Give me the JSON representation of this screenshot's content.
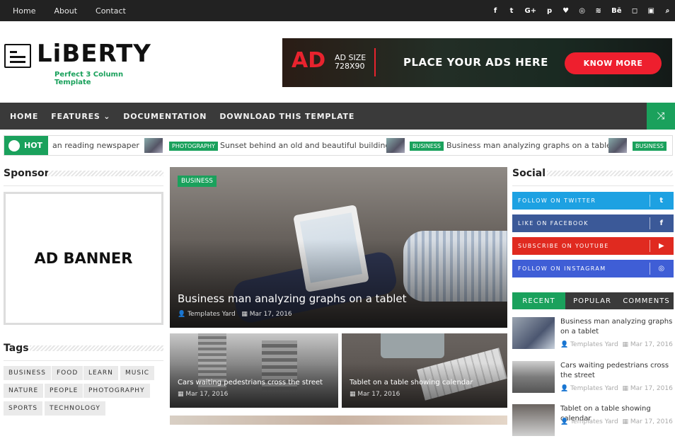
{
  "topbar": {
    "links": [
      "Home",
      "About",
      "Contact"
    ],
    "social_icons": [
      "facebook-icon",
      "twitter-icon",
      "google-plus-icon",
      "pinterest-icon",
      "heart-icon",
      "dribbble-icon",
      "rss-icon",
      "behance-icon",
      "instagram-icon",
      "random-icon",
      "search-icon"
    ],
    "social_glyphs": [
      "f",
      "t",
      "G+",
      "p",
      "♥",
      "◎",
      "≋",
      "Bē",
      "◻",
      "▣",
      "⌕"
    ]
  },
  "logo": {
    "title": "LiBERTY",
    "subtitle": "Perfect 3 Column Template"
  },
  "ad_top": {
    "ad": "AD",
    "size": "AD SIZE",
    "dims": "728X90",
    "place": "PLACE YOUR ADS HERE",
    "button": "KNOW MORE"
  },
  "nav": {
    "items": [
      "HOME",
      "FEATURES ⌄",
      "DOCUMENTATION",
      "DOWNLOAD THIS TEMPLATE"
    ],
    "shuffle_icon": "⤨"
  },
  "ticker": {
    "hot": "HOT",
    "items": [
      {
        "title": "an reading newspaper"
      },
      {
        "label": "PHOTOGRAPHY",
        "title": "Sunset behind an old and beautiful building"
      },
      {
        "label": "BUSINESS",
        "title": "Business man analyzing graphs on a tablet"
      },
      {
        "label": "BUSINESS",
        "title": ""
      }
    ]
  },
  "left": {
    "sponsor_title": "Sponsor",
    "ad_banner": "AD BANNER",
    "tags_title": "Tags",
    "tags": [
      "BUSINESS",
      "FOOD",
      "LEARN",
      "MUSIC",
      "NATURE",
      "PEOPLE",
      "PHOTOGRAPHY",
      "SPORTS",
      "TECHNOLOGY"
    ]
  },
  "featured": {
    "label": "BUSINESS",
    "title": "Business man analyzing graphs on a tablet",
    "author": "Templates Yard",
    "date": "Mar 17, 2016"
  },
  "sub_posts": [
    {
      "title": "Cars waiting pedestrians cross the street",
      "date": "Mar 17, 2016"
    },
    {
      "title": "Tablet on a table showing calendar",
      "date": "Mar 17, 2016"
    }
  ],
  "right": {
    "social_title": "Social",
    "social": [
      {
        "label": "FOLLOW ON TWITTER",
        "icon": "t",
        "color": "#1da1e2"
      },
      {
        "label": "LIKE ON FACEBOOK",
        "icon": "f",
        "color": "#3b5998"
      },
      {
        "label": "SUBSCRIBE ON YOUTUBE",
        "icon": "▶",
        "color": "#e02a20"
      },
      {
        "label": "FOLLOW ON INSTAGRAM",
        "icon": "◎",
        "color": "#3f5ed6"
      }
    ],
    "tabs": [
      "RECENT",
      "POPULAR",
      "COMMENTS"
    ],
    "recent": [
      {
        "title": "Business man analyzing graphs on a tablet",
        "author": "Templates Yard",
        "date": "Mar 17, 2016"
      },
      {
        "title": "Cars waiting pedestrians cross the street",
        "author": "Templates Yard",
        "date": "Mar 17, 2016"
      },
      {
        "title": "Tablet on a table showing calendar",
        "author": "Templates Yard",
        "date": "Mar 17, 2016"
      }
    ]
  },
  "colors": {
    "accent": "#1aa15c",
    "nav": "#3a3a3a",
    "topbar": "#222222"
  }
}
